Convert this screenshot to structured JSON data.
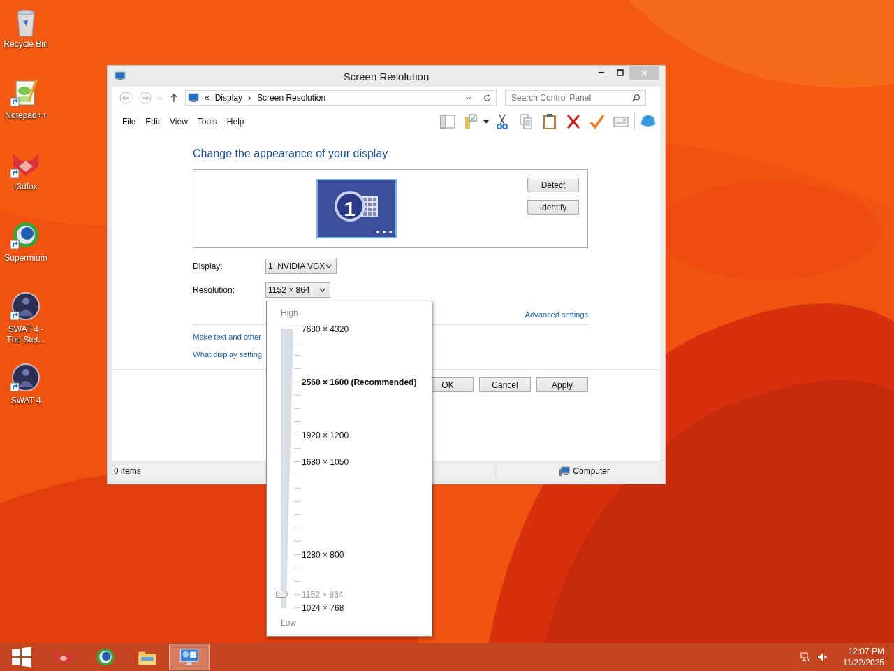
{
  "desktop_icons": [
    {
      "label": "Recycle Bin",
      "kind": "recycle-bin",
      "shortcut": false
    },
    {
      "label": "Notepad++",
      "kind": "notepad",
      "shortcut": true
    },
    {
      "label": "r3dfox",
      "kind": "fox",
      "shortcut": true
    },
    {
      "label": "Supermium",
      "kind": "browser",
      "shortcut": true
    },
    {
      "label": "SWAT 4 - The Stet...",
      "kind": "soldier",
      "shortcut": true
    },
    {
      "label": "SWAT 4",
      "kind": "soldier",
      "shortcut": true
    }
  ],
  "window": {
    "title": "Screen Resolution",
    "overflow_mark": "«",
    "breadcrumb": [
      "Display",
      "Screen Resolution"
    ],
    "search": {
      "placeholder": "Search Control Panel"
    },
    "menu": [
      "File",
      "Edit",
      "View",
      "Tools",
      "Help"
    ],
    "heading": "Change the appearance of your display",
    "monitor_number": "1",
    "side_buttons": [
      "Detect",
      "Identify"
    ],
    "fields": [
      {
        "label": "Display:",
        "value": "1. NVIDIA VGX"
      },
      {
        "label": "Resolution:",
        "value": "1152 × 864"
      }
    ],
    "advanced_link": "Advanced settings",
    "links": [
      "Make text and other",
      "What display setting"
    ],
    "buttons": [
      "OK",
      "Cancel",
      "Apply"
    ],
    "status_bar": {
      "items": "0 items",
      "location": "Computer"
    }
  },
  "resolution_dropdown": {
    "high_label": "High",
    "low_label": "Low",
    "level": 0.048,
    "options": [
      {
        "label": "7680 × 4320",
        "recommended": false,
        "selected": false
      },
      {
        "label": "2560 × 1600 (Recommended)",
        "recommended": true,
        "selected": false
      },
      {
        "label": "1920 × 1200",
        "recommended": false,
        "selected": false
      },
      {
        "label": "1680 × 1050",
        "recommended": false,
        "selected": false
      },
      {
        "label": "1280 × 800",
        "recommended": false,
        "selected": false
      },
      {
        "label": "1152 × 864",
        "recommended": false,
        "selected": true
      },
      {
        "label": "1024 × 768",
        "recommended": false,
        "selected": false
      }
    ]
  },
  "taskbar": {
    "apps": [
      {
        "kind": "start",
        "selected": false
      },
      {
        "kind": "fox",
        "selected": false
      },
      {
        "kind": "browser",
        "selected": false
      },
      {
        "kind": "folder",
        "selected": false
      },
      {
        "kind": "display",
        "selected": true
      }
    ],
    "time": "12:07 PM",
    "date": "11/22/2025"
  }
}
